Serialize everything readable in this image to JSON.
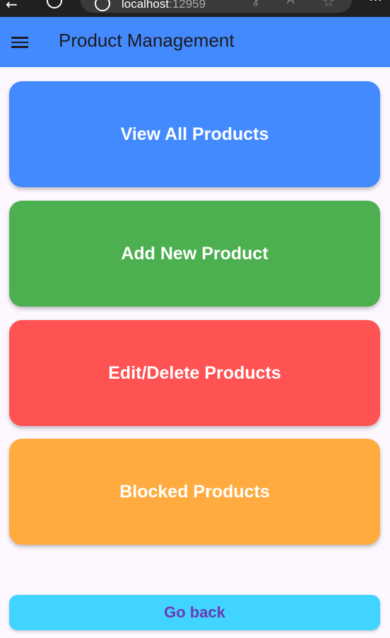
{
  "browser": {
    "url_host": "localhost",
    "url_port": ":12959"
  },
  "app_bar": {
    "title": "Product Management",
    "color": "#448aff"
  },
  "actions": [
    {
      "label": "View All Products",
      "color": "#448aff"
    },
    {
      "label": "Add New Product",
      "color": "#4caf50"
    },
    {
      "label": "Edit/Delete Products",
      "color": "#ff5252"
    },
    {
      "label": "Blocked Products",
      "color": "#ffab40"
    }
  ],
  "go_back": {
    "label": "Go back",
    "color": "#40d4ff",
    "text_color": "#6a3ab3"
  },
  "icons": {
    "menu": "menu-icon",
    "back": "arrow-left-icon",
    "refresh": "refresh-icon",
    "info": "info-icon",
    "key": "key-icon",
    "read_aloud": "read-aloud-icon",
    "favorite": "star-icon",
    "more": "more-icon"
  }
}
